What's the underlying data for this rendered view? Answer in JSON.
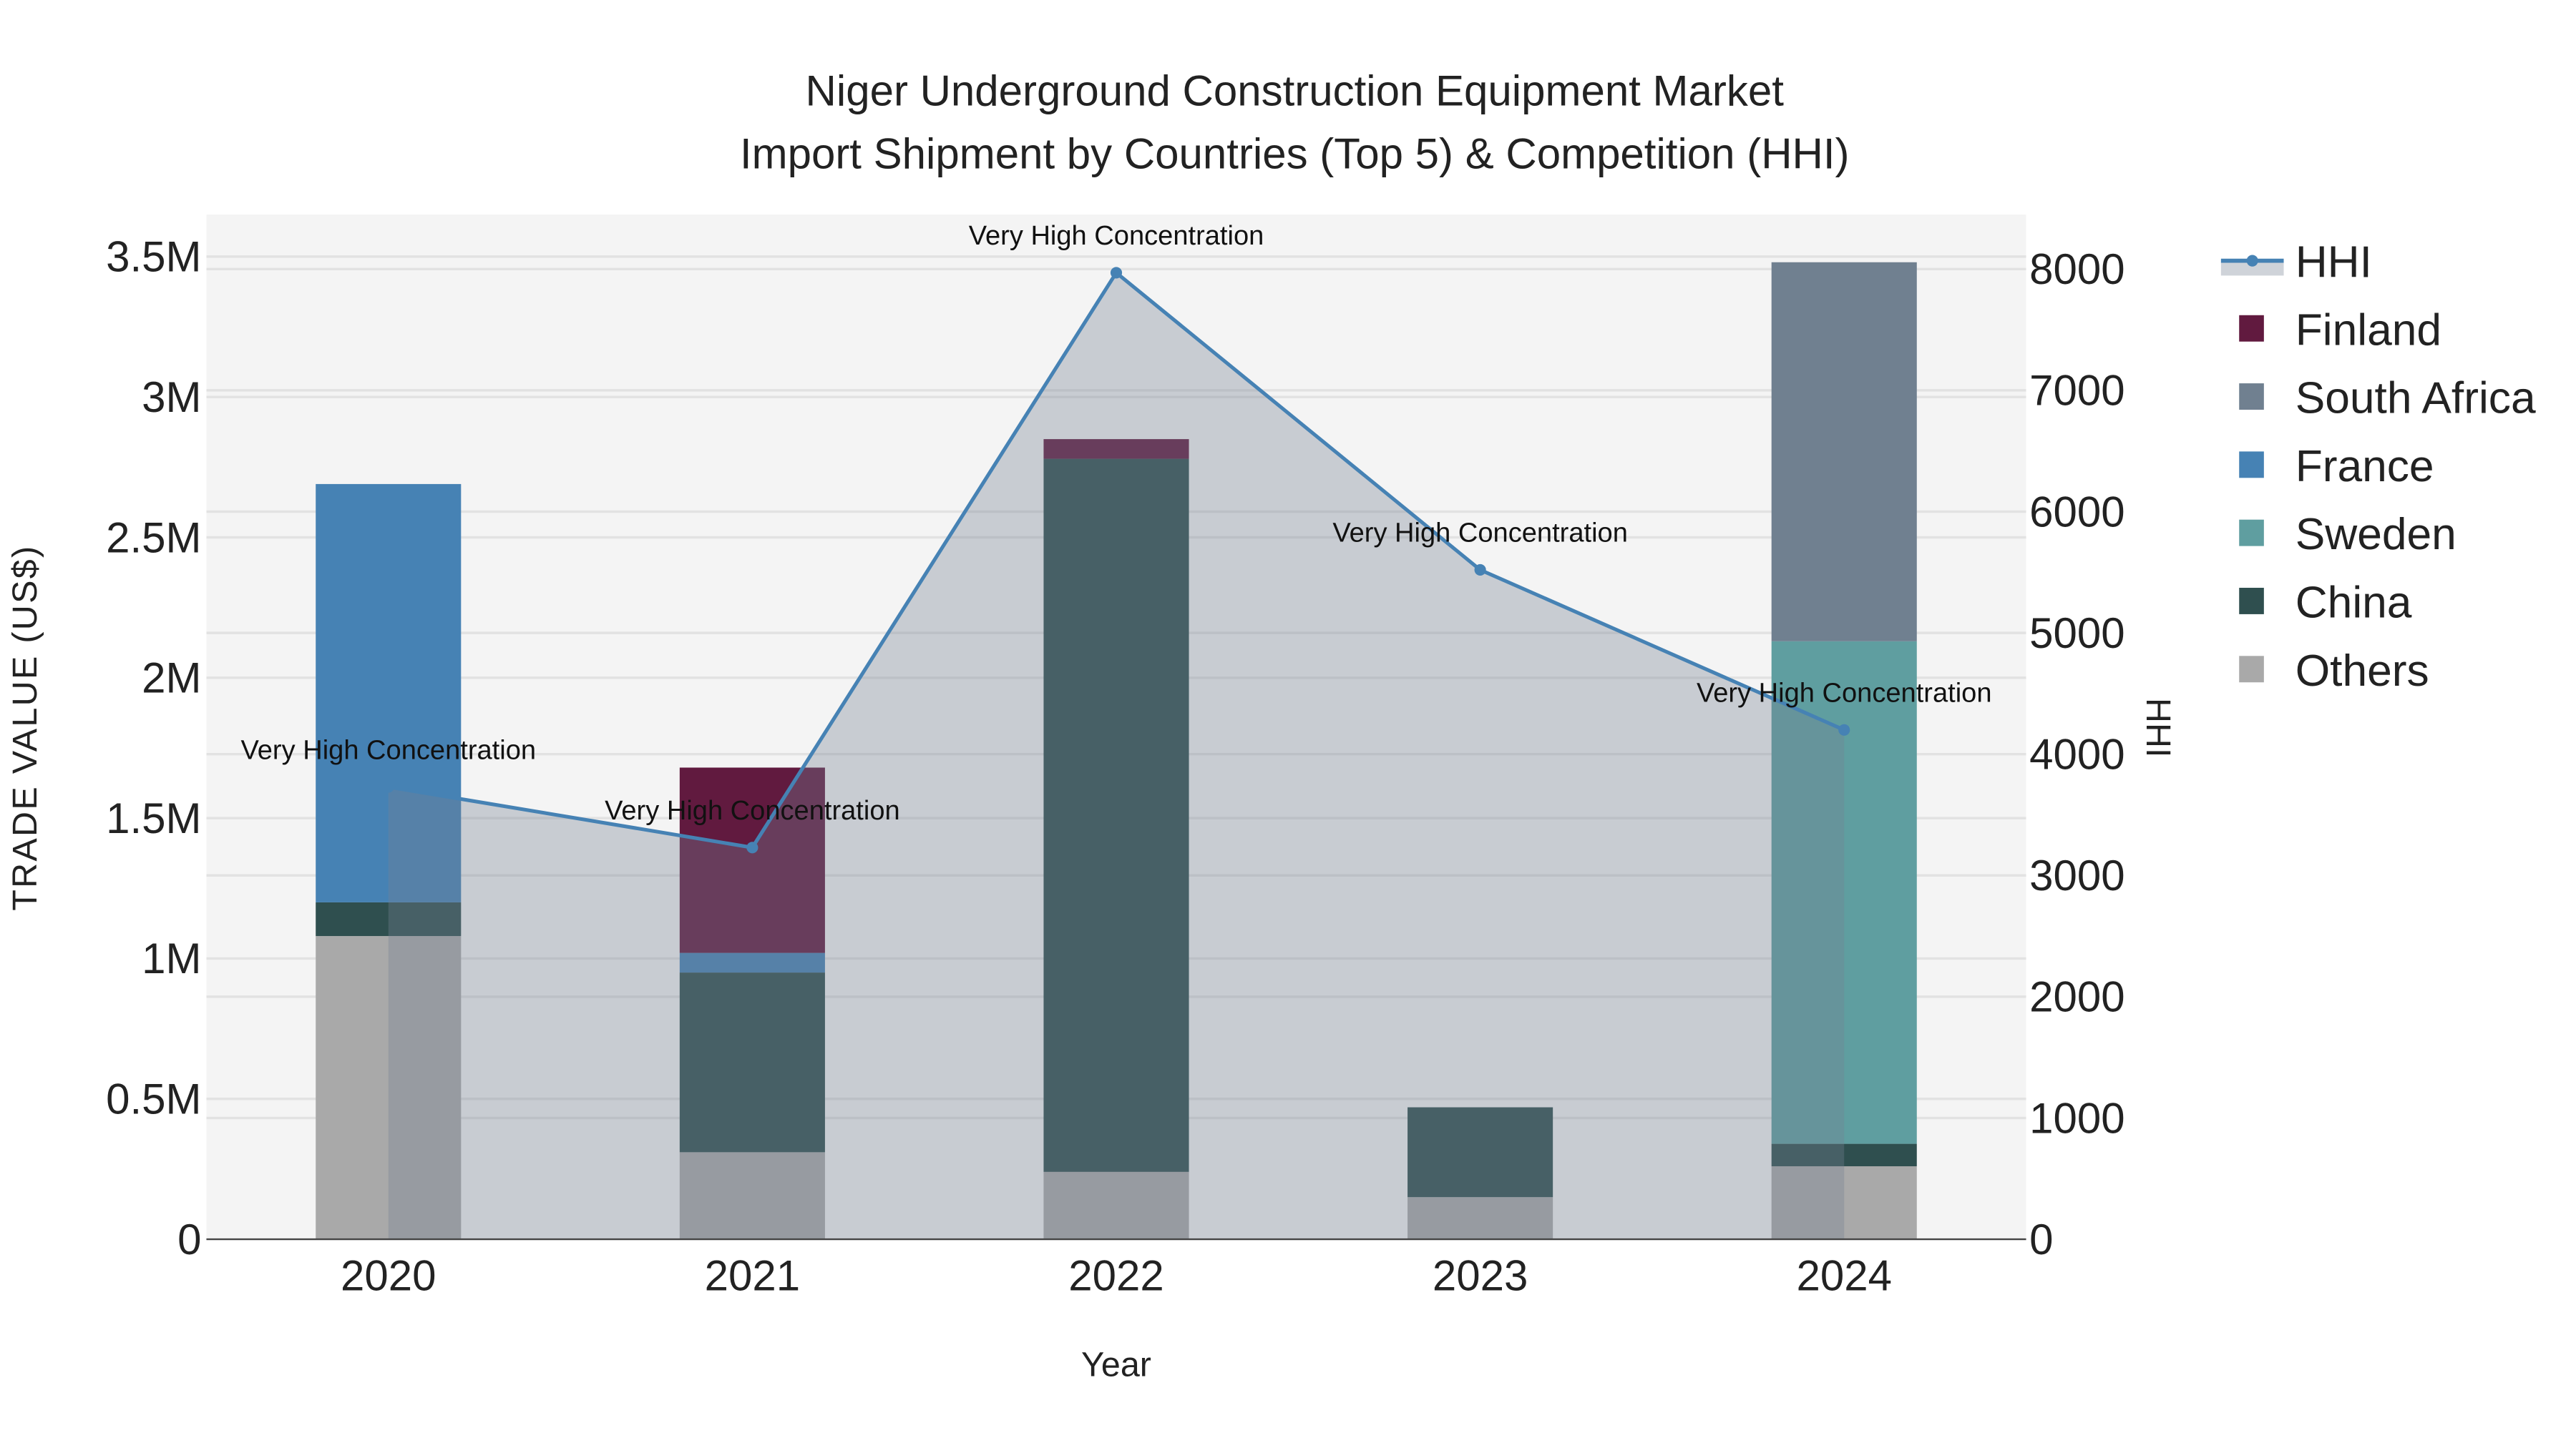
{
  "chart_data": {
    "type": "bar",
    "title_line1": "Niger Underground Construction Equipment Market",
    "title_line2": "Import Shipment by Countries (Top 5) & Competition (HHI)",
    "xlabel": "Year",
    "ylabel": "TRADE VALUE (US$)",
    "y2label": "HHI",
    "categories": [
      "2020",
      "2021",
      "2022",
      "2023",
      "2024"
    ],
    "ylim": [
      0,
      3650000
    ],
    "y2lim": [
      0,
      8450
    ],
    "yticks": [
      {
        "v": 0,
        "l": "0"
      },
      {
        "v": 500000,
        "l": "0.5M"
      },
      {
        "v": 1000000,
        "l": "1M"
      },
      {
        "v": 1500000,
        "l": "1.5M"
      },
      {
        "v": 2000000,
        "l": "2M"
      },
      {
        "v": 2500000,
        "l": "2.5M"
      },
      {
        "v": 3000000,
        "l": "3M"
      },
      {
        "v": 3500000,
        "l": "3.5M"
      }
    ],
    "y2ticks": [
      {
        "v": 0,
        "l": "0"
      },
      {
        "v": 1000,
        "l": "1000"
      },
      {
        "v": 2000,
        "l": "2000"
      },
      {
        "v": 3000,
        "l": "3000"
      },
      {
        "v": 4000,
        "l": "4000"
      },
      {
        "v": 5000,
        "l": "5000"
      },
      {
        "v": 6000,
        "l": "6000"
      },
      {
        "v": 7000,
        "l": "7000"
      },
      {
        "v": 8000,
        "l": "8000"
      }
    ],
    "stack_order": [
      "Others",
      "China",
      "Sweden",
      "France",
      "South Africa",
      "Finland"
    ],
    "series": [
      {
        "name": "Finland",
        "color": "#611a3f",
        "values": [
          0,
          660000,
          70000,
          0,
          0
        ]
      },
      {
        "name": "South Africa",
        "color": "#708090",
        "values": [
          0,
          0,
          0,
          0,
          1350000
        ]
      },
      {
        "name": "France",
        "color": "#4682b4",
        "values": [
          1490000,
          70000,
          0,
          0,
          0
        ]
      },
      {
        "name": "Sweden",
        "color": "#5f9ea0",
        "values": [
          0,
          0,
          0,
          0,
          1790000
        ]
      },
      {
        "name": "China",
        "color": "#2f4f4f",
        "values": [
          120000,
          640000,
          2540000,
          320000,
          80000
        ]
      },
      {
        "name": "Others",
        "color": "#a9a9a9",
        "values": [
          1080000,
          310000,
          240000,
          150000,
          260000
        ]
      }
    ],
    "hhi": {
      "name": "HHI",
      "color": "#4682b4",
      "values": [
        3730,
        3230,
        7970,
        5520,
        4200
      ],
      "annotations": [
        "Very High Concentration",
        "Very High Concentration",
        "Very High Concentration",
        "Very High Concentration",
        "Very High Concentration"
      ]
    },
    "legend_position": "right",
    "grid": true
  }
}
